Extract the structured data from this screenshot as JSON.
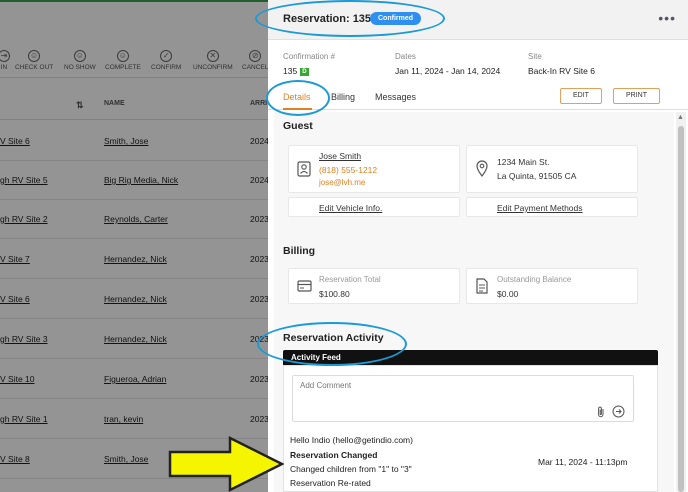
{
  "toolbar": {
    "items": [
      {
        "label": "IN"
      },
      {
        "label": "CHECK OUT"
      },
      {
        "label": "NO SHOW"
      },
      {
        "label": "COMPLETE"
      },
      {
        "label": "CONFIRM"
      },
      {
        "label": "UNCONFIRM"
      },
      {
        "label": "CANCEL"
      }
    ]
  },
  "list": {
    "headers": {
      "name": "NAME",
      "arrival": "ARRI"
    },
    "rows": [
      {
        "site": "V Site 6",
        "name": "Smith, Jose",
        "arrival": "2024"
      },
      {
        "site": "gh RV Site 5",
        "name": "Big Rig Media, Nick",
        "arrival": "2024"
      },
      {
        "site": "gh RV Site 2",
        "name": "Reynolds, Carter",
        "arrival": "2023"
      },
      {
        "site": "V Site 7",
        "name": "Hernandez, Nick",
        "arrival": "2023"
      },
      {
        "site": "V Site 6",
        "name": "Hernandez, Nick",
        "arrival": "2023"
      },
      {
        "site": "gh RV Site 3",
        "name": "Hernandez, Nick",
        "arrival": "2023"
      },
      {
        "site": "V Site 10",
        "name": "Figueroa, Adrian",
        "arrival": "2023"
      },
      {
        "site": "gh RV Site 1",
        "name": "tran, kevin",
        "arrival": "2023"
      },
      {
        "site": "V Site 8",
        "name": "Smith, Jose",
        "arrival": "2023"
      }
    ]
  },
  "panel": {
    "title": "Reservation: 135",
    "status": "Confirmed",
    "meta": {
      "confirmation_label": "Confirmation #",
      "confirmation_value": "135",
      "confirmation_badge": "D",
      "dates_label": "Dates",
      "dates_value": "Jan 11, 2024 - Jan 14, 2024",
      "site_label": "Site",
      "site_value": "Back-In RV Site 6"
    },
    "tabs": [
      "Details",
      "Billing",
      "Messages"
    ],
    "buttons": {
      "edit": "EDIT",
      "print": "PRINT"
    },
    "guest": {
      "section_title": "Guest",
      "name": "Jose Smith",
      "phone": "(818) 555-1212",
      "email": "jose@lvh.me",
      "address_line1": "1234 Main St.",
      "address_line2": "La Quinta, 91505 CA",
      "edit_vehicle": "Edit Vehicle Info.",
      "edit_payment": "Edit Payment Methods"
    },
    "billing": {
      "section_title": "Billing",
      "total_label": "Reservation Total",
      "total_value": "$100.80",
      "balance_label": "Outstanding Balance",
      "balance_value": "$0.00"
    },
    "activity": {
      "section_title": "Reservation Activity",
      "feed_title": "Activity Feed",
      "comment_placeholder": "Add Comment",
      "entry": {
        "author": "Hello Indio (hello@getindio.com)",
        "title": "Reservation Changed",
        "detail1": "Changed children from \"1\" to \"3\"",
        "detail2": "Reservation Re-rated",
        "timestamp": "Mar 11, 2024 - 11:13pm"
      }
    }
  },
  "colors": {
    "accent": "#e0801f",
    "badge": "#2e8ff0",
    "annotation_ring": "#1b9ad6",
    "annotation_arrow": "#f5f500"
  }
}
